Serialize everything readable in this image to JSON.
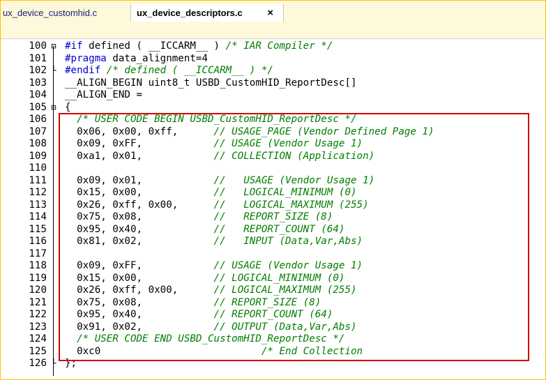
{
  "tabs": [
    {
      "label": "ux_device_customhid.c",
      "active": false
    },
    {
      "label": "ux_device_descriptors.c",
      "active": true,
      "close": "×"
    }
  ],
  "lines": [
    {
      "num": "100",
      "fold": "⊟",
      "parts": [
        [
          "pre",
          "#if"
        ],
        [
          "n",
          " defined ( __ICCARM__ ) "
        ],
        [
          "cm",
          "/* IAR Compiler */"
        ]
      ]
    },
    {
      "num": "101",
      "fold": "",
      "parts": [
        [
          "pre",
          "#pragma"
        ],
        [
          "n",
          " data_alignment=4"
        ]
      ]
    },
    {
      "num": "102",
      "fold": "└",
      "parts": [
        [
          "pre",
          "#endif"
        ],
        [
          "n",
          " "
        ],
        [
          "cm",
          "/* defined ( __ICCARM__ ) */"
        ]
      ]
    },
    {
      "num": "103",
      "fold": "",
      "parts": [
        [
          "n",
          "__ALIGN_BEGIN uint8_t USBD_CustomHID_ReportDesc[]"
        ]
      ]
    },
    {
      "num": "104",
      "fold": "",
      "parts": [
        [
          "n",
          "__ALIGN_END ="
        ]
      ]
    },
    {
      "num": "105",
      "fold": "⊟",
      "parts": [
        [
          "n",
          "{"
        ]
      ]
    },
    {
      "num": "106",
      "fold": "",
      "parts": [
        [
          "n",
          "  "
        ],
        [
          "cm",
          "/* USER CODE BEGIN USBD_CustomHID_ReportDesc */"
        ]
      ]
    },
    {
      "num": "107",
      "fold": "",
      "parts": [
        [
          "n",
          "  0x06, 0x00, 0xff,      "
        ],
        [
          "cm",
          "// USAGE_PAGE (Vendor Defined Page 1)"
        ]
      ]
    },
    {
      "num": "108",
      "fold": "",
      "parts": [
        [
          "n",
          "  0x09, 0xFF,            "
        ],
        [
          "cm",
          "// USAGE (Vendor Usage 1)"
        ]
      ]
    },
    {
      "num": "109",
      "fold": "",
      "parts": [
        [
          "n",
          "  0xa1, 0x01,            "
        ],
        [
          "cm",
          "// COLLECTION (Application)"
        ]
      ]
    },
    {
      "num": "110",
      "fold": "",
      "parts": []
    },
    {
      "num": "111",
      "fold": "",
      "parts": [
        [
          "n",
          "  0x09, 0x01,            "
        ],
        [
          "cm",
          "//   USAGE (Vendor Usage 1)"
        ]
      ]
    },
    {
      "num": "112",
      "fold": "",
      "parts": [
        [
          "n",
          "  0x15, 0x00,            "
        ],
        [
          "cm",
          "//   LOGICAL_MINIMUM (0)"
        ]
      ]
    },
    {
      "num": "113",
      "fold": "",
      "parts": [
        [
          "n",
          "  0x26, 0xff, 0x00,      "
        ],
        [
          "cm",
          "//   LOGICAL_MAXIMUM (255)"
        ]
      ]
    },
    {
      "num": "114",
      "fold": "",
      "parts": [
        [
          "n",
          "  0x75, 0x08,            "
        ],
        [
          "cm",
          "//   REPORT_SIZE (8)"
        ]
      ]
    },
    {
      "num": "115",
      "fold": "",
      "parts": [
        [
          "n",
          "  0x95, 0x40,            "
        ],
        [
          "cm",
          "//   REPORT_COUNT (64)"
        ]
      ]
    },
    {
      "num": "116",
      "fold": "",
      "parts": [
        [
          "n",
          "  0x81, 0x02,            "
        ],
        [
          "cm",
          "//   INPUT (Data,Var,Abs)"
        ]
      ]
    },
    {
      "num": "117",
      "fold": "",
      "parts": []
    },
    {
      "num": "118",
      "fold": "",
      "parts": [
        [
          "n",
          "  0x09, 0xFF,            "
        ],
        [
          "cm",
          "// USAGE (Vendor Usage 1)"
        ]
      ]
    },
    {
      "num": "119",
      "fold": "",
      "parts": [
        [
          "n",
          "  0x15, 0x00,            "
        ],
        [
          "cm",
          "// LOGICAL_MINIMUM (0)"
        ]
      ]
    },
    {
      "num": "120",
      "fold": "",
      "parts": [
        [
          "n",
          "  0x26, 0xff, 0x00,      "
        ],
        [
          "cm",
          "// LOGICAL_MAXIMUM (255)"
        ]
      ]
    },
    {
      "num": "121",
      "fold": "",
      "parts": [
        [
          "n",
          "  0x75, 0x08,            "
        ],
        [
          "cm",
          "// REPORT_SIZE (8)"
        ]
      ]
    },
    {
      "num": "122",
      "fold": "",
      "parts": [
        [
          "n",
          "  0x95, 0x40,            "
        ],
        [
          "cm",
          "// REPORT_COUNT (64)"
        ]
      ]
    },
    {
      "num": "123",
      "fold": "",
      "parts": [
        [
          "n",
          "  0x91, 0x02,            "
        ],
        [
          "cm",
          "// OUTPUT (Data,Var,Abs)"
        ]
      ]
    },
    {
      "num": "124",
      "fold": "",
      "parts": [
        [
          "n",
          "  "
        ],
        [
          "cm",
          "/* USER CODE END USBD_CustomHID_ReportDesc */"
        ]
      ]
    },
    {
      "num": "125",
      "fold": "",
      "parts": [
        [
          "n",
          "  0xc0                           "
        ],
        [
          "cm",
          "/* End Collection"
        ]
      ]
    },
    {
      "num": "126",
      "fold": "└",
      "parts": [
        [
          "n",
          "};"
        ]
      ]
    }
  ],
  "colors": {
    "preprocessor": "#0000c8",
    "comment": "#007d00",
    "highlight_box": "#d40000",
    "tab_bar": "#fff9dc"
  }
}
